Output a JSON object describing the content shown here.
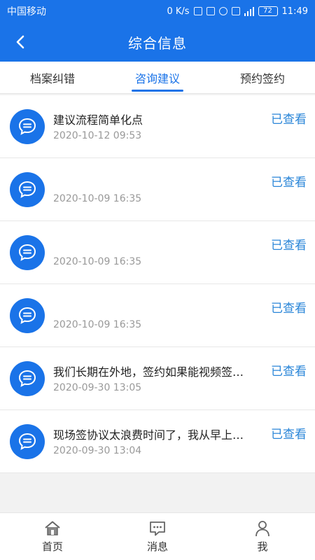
{
  "status_bar": {
    "carrier": "中国移动",
    "speed": "0 K/s",
    "battery": "72",
    "time": "11:49"
  },
  "header": {
    "title": "综合信息"
  },
  "tabs": [
    {
      "label": "档案纠错"
    },
    {
      "label": "咨询建议"
    },
    {
      "label": "预约签约"
    }
  ],
  "items": [
    {
      "title": "建议流程简单化点",
      "time": "2020-10-12 09:53",
      "status": "已查看"
    },
    {
      "title": "",
      "time": "2020-10-09 16:35",
      "status": "已查看"
    },
    {
      "title": "",
      "time": "2020-10-09 16:35",
      "status": "已查看"
    },
    {
      "title": "",
      "time": "2020-10-09 16:35",
      "status": "已查看"
    },
    {
      "title": "我们长期在外地，签约如果能视频签…",
      "time": "2020-09-30 13:05",
      "status": "已查看"
    },
    {
      "title": "现场签协议太浪费时间了，我从早上…",
      "time": "2020-09-30 13:04",
      "status": "已查看"
    }
  ],
  "bottom_nav": [
    {
      "label": "首页",
      "icon": "home-icon"
    },
    {
      "label": "消息",
      "icon": "message-icon"
    },
    {
      "label": "我",
      "icon": "user-icon"
    }
  ],
  "colors": {
    "primary": "#1a73e8",
    "status_text": "#2a86d8"
  }
}
